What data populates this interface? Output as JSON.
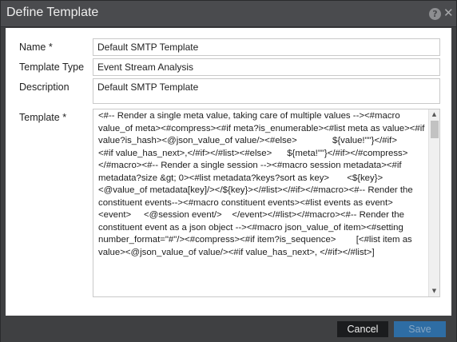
{
  "dialog": {
    "title": "Define Template",
    "help_icon": "question-circle-icon",
    "close_icon": "close-icon"
  },
  "form": {
    "name": {
      "label": "Name *",
      "value": "Default SMTP Template"
    },
    "template_type": {
      "label": "Template Type",
      "value": "Event Stream Analysis"
    },
    "description": {
      "label": "Description",
      "value": "Default SMTP Template"
    },
    "template": {
      "label": "Template *",
      "value": "<#-- Render a single meta value, taking care of multiple values --><#macro value_of meta><#compress><#if meta?is_enumerable><#list meta as value><#if value?is_hash><@json_value_of value/><#else>              ${value!\"\"}</#if>          <#if value_has_next>,</#if></#list><#else>      ${meta!\"\"}</#if></#compress></#macro><#-- Render a single session --><#macro session metadata><#if metadata?size &gt; 0><#list metadata?keys?sort as key>       <${key}><@value_of metadata[key]/></${key}></#list></#if></#macro><#-- Render the constituent events--><#macro constituent events><#list events as event>    <event>     <@session event/>    </event></#list></#macro><#-- Render the constituent event as a json object --><#macro json_value_of item><#setting number_format=\"#\"/><#compress><#if item?is_sequence>        [<#list item as value><@json_value_of value/><#if value_has_next>, </#if></#list>]"
    }
  },
  "footer": {
    "cancel_label": "Cancel",
    "save_label": "Save"
  },
  "colors": {
    "dialog_bg": "#3f4042",
    "titlebar_bg": "#4a4b4e",
    "save_button": "#2e6da4",
    "cancel_button": "#1b1c1e"
  }
}
